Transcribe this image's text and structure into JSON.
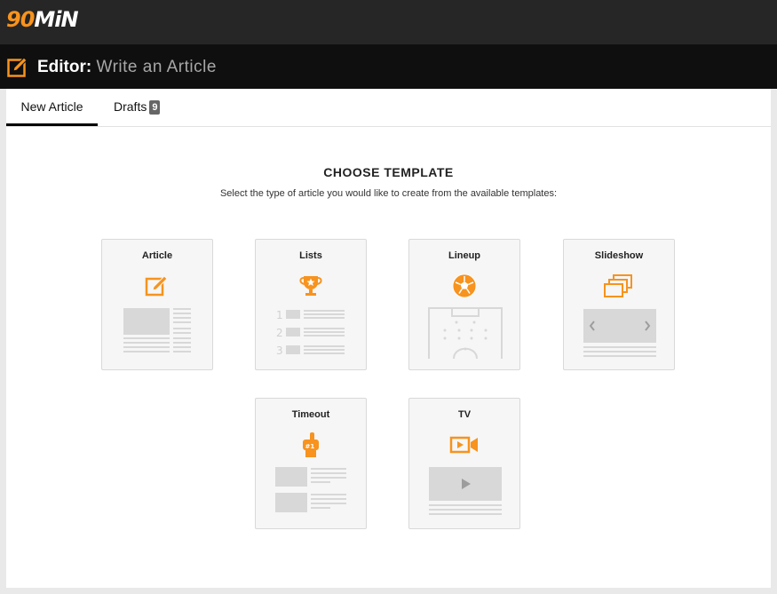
{
  "app": {
    "logo_number": "90",
    "logo_text": "MiN"
  },
  "editor": {
    "label": "Editor:",
    "subtitle": "Write an Article"
  },
  "tabs": [
    {
      "label": "New Article",
      "active": true
    },
    {
      "label": "Drafts",
      "badge": "9",
      "active": false
    }
  ],
  "main": {
    "heading": "CHOOSE TEMPLATE",
    "description": "Select the type of article you would like to create from the available templates:"
  },
  "templates": [
    {
      "title": "Article",
      "icon": "edit-icon"
    },
    {
      "title": "Lists",
      "icon": "trophy-icon"
    },
    {
      "title": "Lineup",
      "icon": "soccer-ball-icon"
    },
    {
      "title": "Slideshow",
      "icon": "stacked-images-icon"
    },
    {
      "title": "Timeout",
      "icon": "foam-finger-icon",
      "icon_text": "#1"
    },
    {
      "title": "TV",
      "icon": "video-camera-icon"
    }
  ],
  "colors": {
    "accent": "#f7931e",
    "topbar": "#262626",
    "editorbar": "#0f0f0f",
    "placeholder": "#d8d8d8"
  }
}
